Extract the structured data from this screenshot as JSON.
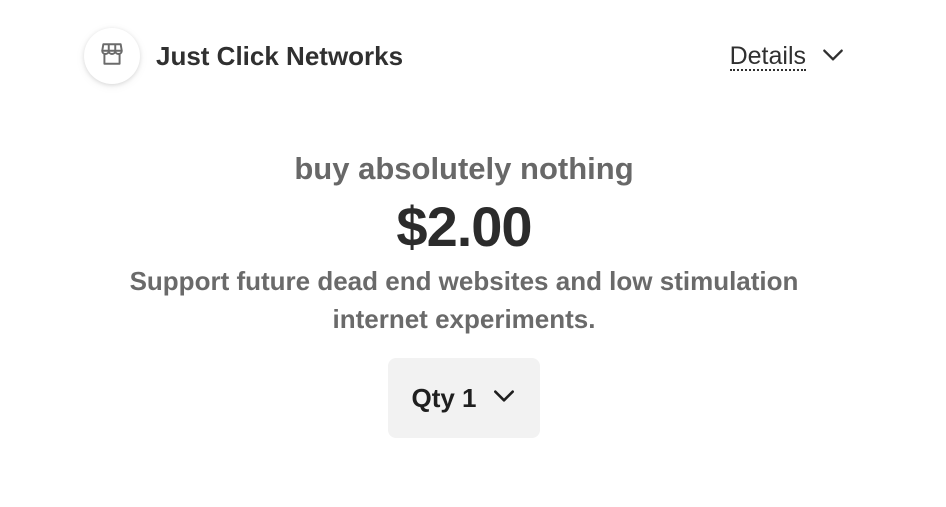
{
  "header": {
    "merchant_name": "Just Click Networks",
    "logo_icon": "store-icon",
    "details_label": "Details",
    "details_icon": "chevron-down-icon"
  },
  "product": {
    "name": "buy absolutely nothing",
    "price": "$2.00",
    "description": "Support future dead end websites and low stimulation internet experiments."
  },
  "quantity": {
    "label": "Qty 1",
    "value": 1,
    "icon": "chevron-down-icon"
  }
}
